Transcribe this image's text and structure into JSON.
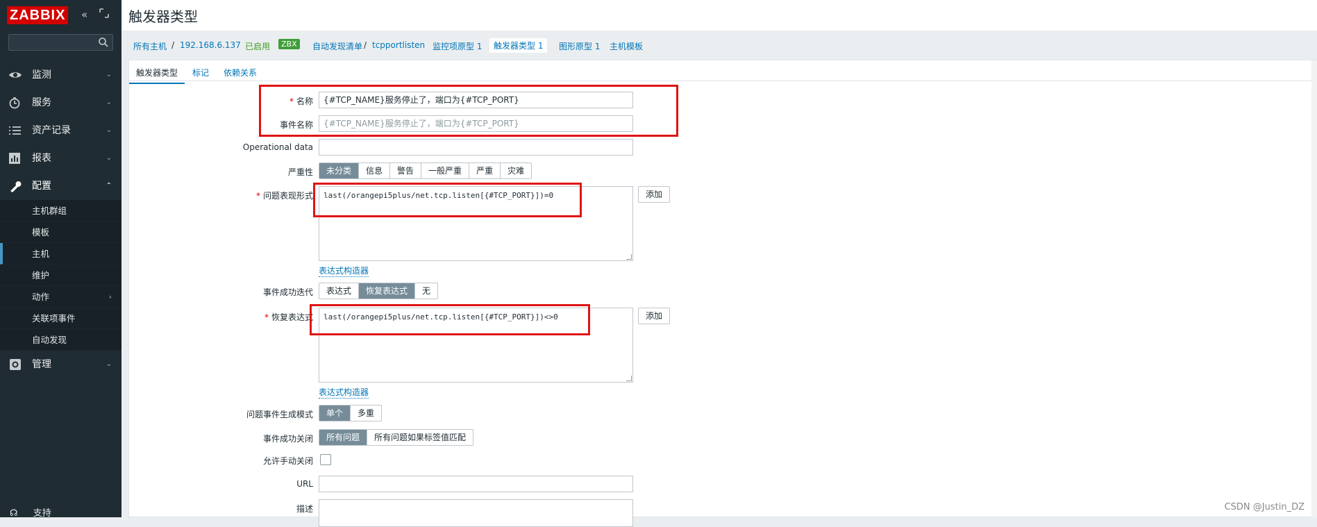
{
  "app": {
    "logo": "ZABBIX",
    "page_title": "触发器类型"
  },
  "sidebar": {
    "items": [
      {
        "label": "监测",
        "icon": "eye-icon"
      },
      {
        "label": "服务",
        "icon": "clock-icon"
      },
      {
        "label": "资产记录",
        "icon": "list-icon"
      },
      {
        "label": "报表",
        "icon": "bar-chart-icon"
      },
      {
        "label": "配置",
        "icon": "wrench-icon"
      },
      {
        "label": "管理",
        "icon": "gear-icon"
      }
    ],
    "sub_items": [
      "主机群组",
      "模板",
      "主机",
      "维护",
      "动作",
      "关联项事件",
      "自动发现"
    ],
    "support": "支持"
  },
  "breadcrumbs": {
    "all_hosts": "所有主机",
    "sep": "/",
    "host": "192.168.6.137",
    "enabled": "已启用",
    "zbx": "ZBX",
    "discovery_list": "自动发现清单",
    "rule": "tcpportlisten",
    "item_proto": "监控项原型 1",
    "trigger_proto": "触发器类型 1",
    "graph_proto": "图形原型 1",
    "host_template": "主机模板"
  },
  "tabs": [
    "触发器类型",
    "标记",
    "依赖关系"
  ],
  "form": {
    "name_label": "名称",
    "name_value": "{#TCP_NAME}服务停止了，端口为{#TCP_PORT}",
    "event_name_label": "事件名称",
    "event_name_placeholder": "{#TCP_NAME}服务停止了，端口为{#TCP_PORT}",
    "opdata_label": "Operational data",
    "severity_label": "严重性",
    "severities": [
      "未分类",
      "信息",
      "警告",
      "一般严重",
      "严重",
      "灾难"
    ],
    "problem_expr_label": "问题表现形式",
    "problem_expr_value": "last(/orangepi5plus/net.tcp.listen[{#TCP_PORT}])=0",
    "add_label": "添加",
    "expr_builder": "表达式构造器",
    "ok_event_label": "事件成功迭代",
    "ok_event_options": [
      "表达式",
      "恢复表达式",
      "无"
    ],
    "recovery_expr_label": "恢复表达式",
    "recovery_expr_value": "last(/orangepi5plus/net.tcp.listen[{#TCP_PORT}])<>0",
    "gen_mode_label": "问题事件生成模式",
    "gen_mode_options": [
      "单个",
      "多重"
    ],
    "ok_close_label": "事件成功关闭",
    "ok_close_options": [
      "所有问题",
      "所有问题如果标签值匹配"
    ],
    "manual_close_label": "允许手动关闭",
    "url_label": "URL",
    "desc_label": "描述"
  },
  "watermark": "CSDN @Justin_DZ",
  "colors": {
    "sidebar_bg": "#1f2c33",
    "accent": "#0275b8",
    "logo_red": "#d40000",
    "highlight_box": "#e01414"
  }
}
